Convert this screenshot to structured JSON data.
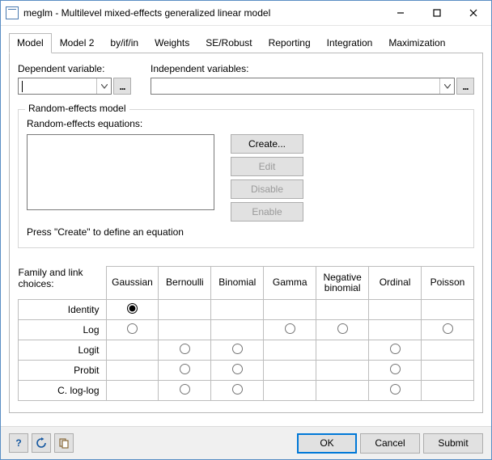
{
  "window": {
    "title": "meglm - Multilevel mixed-effects generalized linear model"
  },
  "tabs": [
    "Model",
    "Model 2",
    "by/if/in",
    "Weights",
    "SE/Robust",
    "Reporting",
    "Integration",
    "Maximization"
  ],
  "active_tab": 0,
  "model": {
    "dep_label": "Dependent variable:",
    "indep_label": "Independent variables:",
    "dep_value": "",
    "indep_value": ""
  },
  "groupbox": {
    "title": "Random-effects model",
    "subtitle": "Random-effects equations:",
    "hint": "Press \"Create\" to define an equation",
    "buttons": {
      "create": "Create...",
      "edit": "Edit",
      "disable": "Disable",
      "enable": "Enable"
    },
    "buttons_enabled": {
      "create": true,
      "edit": false,
      "disable": false,
      "enable": false
    }
  },
  "familylink": {
    "corner": "Family and link choices:",
    "families": [
      "Gaussian",
      "Bernoulli",
      "Binomial",
      "Gamma",
      "Negative binomial",
      "Ordinal",
      "Poisson"
    ],
    "links": [
      "Identity",
      "Log",
      "Logit",
      "Probit",
      "C. log-log"
    ],
    "cells": [
      [
        true,
        false,
        false,
        false,
        false,
        false,
        false
      ],
      [
        true,
        false,
        false,
        true,
        true,
        false,
        true
      ],
      [
        false,
        true,
        true,
        false,
        false,
        true,
        false
      ],
      [
        false,
        true,
        true,
        false,
        false,
        true,
        false
      ],
      [
        false,
        true,
        true,
        false,
        false,
        true,
        false
      ]
    ],
    "selected": "Gaussian|Identity"
  },
  "footer": {
    "ok": "OK",
    "cancel": "Cancel",
    "submit": "Submit"
  },
  "icons": {
    "help": "?",
    "ellipsis": "..."
  }
}
